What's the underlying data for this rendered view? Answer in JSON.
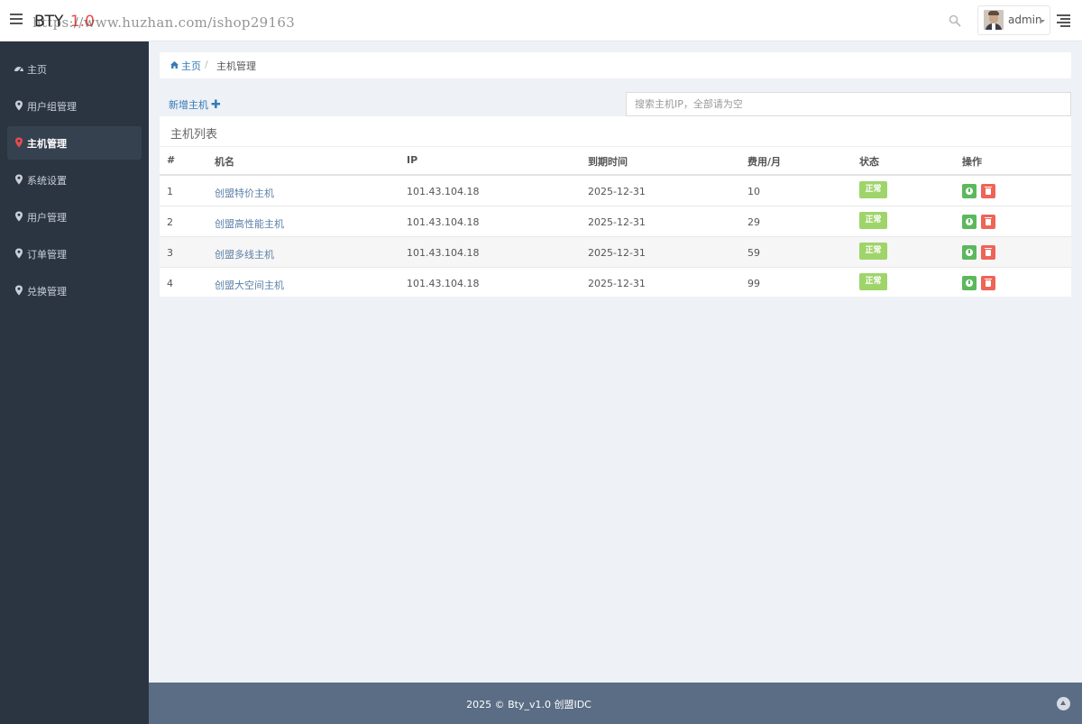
{
  "header": {
    "brand": "BTY",
    "version": "1.0",
    "watermark": "https://www.huzhan.com/ishop29163",
    "user": "admin"
  },
  "icons": {
    "menu": "hamburger-icon",
    "search": "search-icon",
    "right_menu": "align-right-icon",
    "nav_home": "dashboard-icon",
    "nav_item": "map-marker-icon",
    "breadcrumb_home": "home-icon",
    "add": "plus-icon",
    "enable": "power-icon",
    "delete": "trash-icon",
    "to_top": "chevron-up-icon"
  },
  "sidebar": {
    "items": [
      {
        "label": "主页"
      },
      {
        "label": "用户组管理"
      },
      {
        "label": "主机管理",
        "active": true
      },
      {
        "label": "系统设置"
      },
      {
        "label": "用户管理"
      },
      {
        "label": "订单管理"
      },
      {
        "label": "兑换管理"
      }
    ]
  },
  "breadcrumb": {
    "home": "主页",
    "separator": "/",
    "current": "主机管理"
  },
  "toolbar": {
    "add_label": "新增主机",
    "add_symbol": "✚",
    "search_placeholder": "搜索主机IP，全部请为空"
  },
  "table": {
    "title": "主机列表",
    "columns": [
      "#",
      "机名",
      "IP",
      "到期时间",
      "费用/月",
      "状态",
      "操作"
    ],
    "rows": [
      {
        "id": "1",
        "name": "创盟特价主机",
        "ip": "101.43.104.18",
        "expire": "2025-12-31",
        "fee": "10",
        "status": "正常"
      },
      {
        "id": "2",
        "name": "创盟高性能主机",
        "ip": "101.43.104.18",
        "expire": "2025-12-31",
        "fee": "29",
        "status": "正常"
      },
      {
        "id": "3",
        "name": "创盟多线主机",
        "ip": "101.43.104.18",
        "expire": "2025-12-31",
        "fee": "59",
        "status": "正常"
      },
      {
        "id": "4",
        "name": "创盟大空间主机",
        "ip": "101.43.104.18",
        "expire": "2025-12-31",
        "fee": "99",
        "status": "正常"
      }
    ]
  },
  "colors": {
    "sidebar_bg": "#2b3542",
    "active_marker": "#e84c4c",
    "status_ok": "#9fd46a",
    "btn_enable": "#5cb85c",
    "btn_delete": "#ee6456",
    "footer_bg": "#5a6d85",
    "link": "#337ab7"
  },
  "footer": {
    "text": "2025 © Bty_v1.0 创盟IDC"
  }
}
